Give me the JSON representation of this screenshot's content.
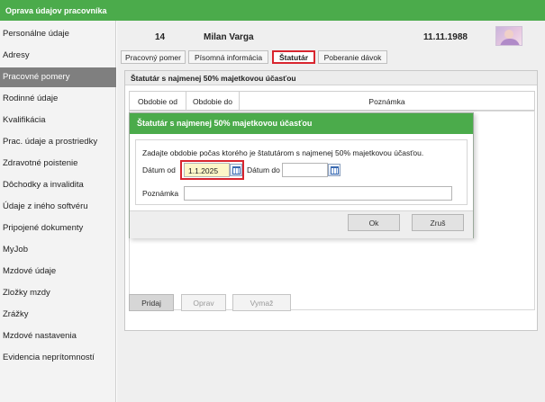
{
  "app": {
    "title": "Oprava údajov pracovníka"
  },
  "sidebar": {
    "items": [
      {
        "label": "Personálne údaje",
        "active": false
      },
      {
        "label": "Adresy",
        "active": false
      },
      {
        "label": "Pracovné pomery",
        "active": true
      },
      {
        "label": "Rodinné údaje",
        "active": false
      },
      {
        "label": "Kvalifikácia",
        "active": false
      },
      {
        "label": "Prac. údaje a prostriedky",
        "active": false
      },
      {
        "label": "Zdravotné poistenie",
        "active": false
      },
      {
        "label": "Dôchodky a invalidita",
        "active": false
      },
      {
        "label": "Údaje z iného softvéru",
        "active": false
      },
      {
        "label": "Pripojené dokumenty",
        "active": false
      },
      {
        "label": "MyJob",
        "active": false
      },
      {
        "label": "Mzdové údaje",
        "active": false
      },
      {
        "label": "Zložky mzdy",
        "active": false
      },
      {
        "label": "Zrážky",
        "active": false
      },
      {
        "label": "Mzdové nastavenia",
        "active": false
      },
      {
        "label": "Evidencia neprítomností",
        "active": false
      }
    ]
  },
  "header": {
    "employee_id": "14",
    "employee_name": "Milan Varga",
    "date": "11.11.1988",
    "avatar_icon": "person-photo"
  },
  "tabs": [
    {
      "label": "Pracovný pomer",
      "active": false
    },
    {
      "label": "Písomná informácia",
      "active": false
    },
    {
      "label": "Štatutár",
      "active": true
    },
    {
      "label": "Poberanie dávok",
      "active": false
    }
  ],
  "panel": {
    "title": "Štatutár s najmenej 50% majetkovou účasťou",
    "columns": [
      "Obdobie od",
      "Obdobie do",
      "Poznámka"
    ],
    "buttons": {
      "add": "Pridaj",
      "edit": "Oprav",
      "delete": "Vymaž"
    }
  },
  "dialog": {
    "title": "Štatutár s najmenej 50% majetkovou účasťou",
    "instruction": "Zadajte obdobie počas ktorého je štatutárom s najmenej 50% majetkovou účasťou.",
    "date_from_label": "Dátum od",
    "date_from_value": "1.1.2025",
    "date_to_label": "Dátum do",
    "date_to_value": "",
    "note_label": "Poznámka",
    "note_value": "",
    "ok_label": "Ok",
    "cancel_label": "Zruš"
  },
  "colors": {
    "accent_green": "#4bab4b",
    "highlight_red": "#d8262f",
    "active_sidebar": "#7f7f7f"
  }
}
